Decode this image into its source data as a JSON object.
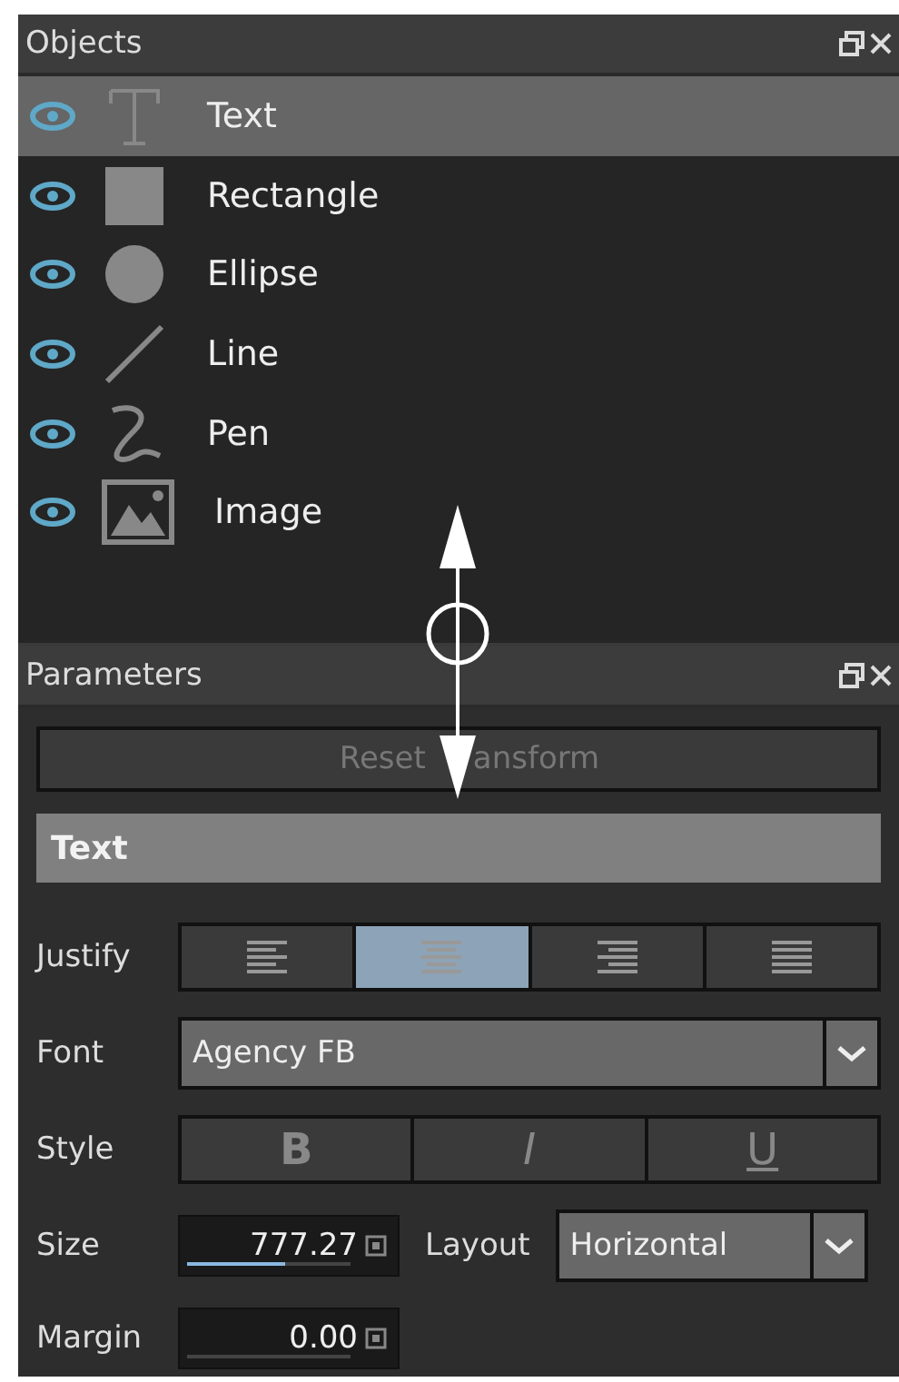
{
  "objects_panel": {
    "title": "Objects",
    "items": [
      {
        "label": "Text",
        "kind": "text",
        "visible": true,
        "selected": true
      },
      {
        "label": "Rectangle",
        "kind": "rectangle",
        "visible": true,
        "selected": false
      },
      {
        "label": "Ellipse",
        "kind": "ellipse",
        "visible": true,
        "selected": false
      },
      {
        "label": "Line",
        "kind": "line",
        "visible": true,
        "selected": false
      },
      {
        "label": "Pen",
        "kind": "pen",
        "visible": true,
        "selected": false
      },
      {
        "label": "Image",
        "kind": "image",
        "visible": true,
        "selected": false
      }
    ]
  },
  "parameters_panel": {
    "title": "Parameters",
    "reset_button": {
      "label_parts": [
        "Reset",
        "ansform"
      ],
      "disabled": true
    },
    "section": "Text",
    "justify": {
      "label": "Justify",
      "options": [
        {
          "kind": "left",
          "selected": false
        },
        {
          "kind": "center",
          "selected": true
        },
        {
          "kind": "right",
          "selected": false
        },
        {
          "kind": "full",
          "selected": false
        }
      ]
    },
    "font": {
      "label": "Font",
      "value": "Agency FB"
    },
    "style": {
      "label": "Style",
      "options": [
        {
          "label": "B",
          "kind": "bold"
        },
        {
          "label": "I",
          "kind": "italic"
        },
        {
          "label": "U",
          "kind": "underline"
        }
      ]
    },
    "size": {
      "label": "Size",
      "value": "777.27",
      "level": 0.6
    },
    "layout": {
      "label": "Layout",
      "value": "Horizontal"
    },
    "margin": {
      "label": "Margin",
      "value": "0.00"
    }
  }
}
